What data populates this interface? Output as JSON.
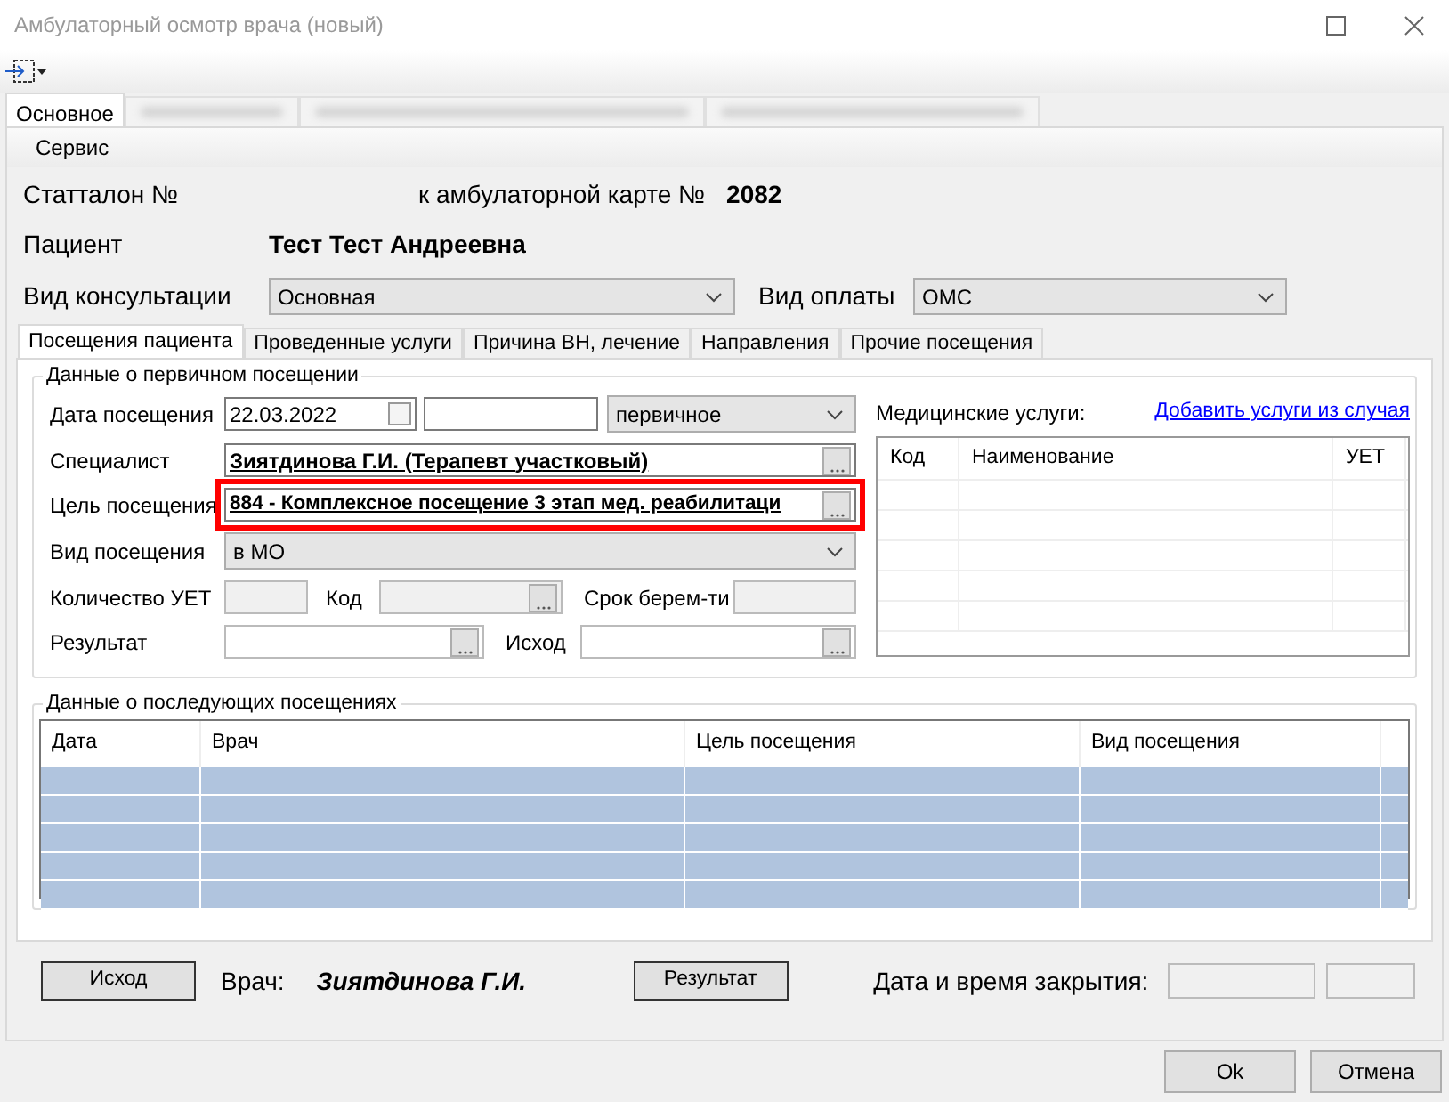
{
  "window": {
    "title": "Амбулаторный осмотр врача (новый)"
  },
  "main_tabs": [
    {
      "label": "Основное",
      "selected": true
    }
  ],
  "menu": [
    "Сервис"
  ],
  "header": {
    "stattalon_label": "Статталон №",
    "card_label": "к амбулаторной карте №",
    "card_number": "2082",
    "patient_label": "Пациент",
    "patient_name": "Тест Тест Андреевна",
    "consult_label": "Вид консультации",
    "consult_value": "Основная",
    "payment_label": "Вид оплаты",
    "payment_value": "ОМС"
  },
  "inner_tabs": [
    {
      "label": "Посещения пациента",
      "selected": true
    },
    {
      "label": "Проведенные услуги",
      "selected": false
    },
    {
      "label": "Причина ВН, лечение",
      "selected": false
    },
    {
      "label": "Направления",
      "selected": false
    },
    {
      "label": "Прочие посещения",
      "selected": false
    }
  ],
  "primary_visit": {
    "title": "Данные о первичном посещении",
    "date_label": "Дата посещения",
    "date_value": "22.03.2022",
    "date_checked": false,
    "visit_type_value": "первичное",
    "specialist_label": "Специалист",
    "specialist_value": "Зиятдинова Г.И. (Терапевт участковый)",
    "purpose_label": "Цель посещения",
    "purpose_value": "884 - Комплексное посещение 3 этап мед. реабилитаци",
    "purpose_highlighted": true,
    "kind_label": "Вид посещения",
    "kind_value": "в МО",
    "uet_label": "Количество УЕТ",
    "code_label": "Код",
    "term_label": "Срок берем-ти",
    "result_label": "Результат",
    "outcome_label": "Исход",
    "services_label": "Медицинские услуги:",
    "services_link": "Добавить услуги из случая",
    "services_columns": [
      "Код",
      "Наименование",
      "УЕТ"
    ]
  },
  "later_visits": {
    "title": "Данные о последующих посещениях",
    "columns": [
      "Дата",
      "Врач",
      "Цель посещения",
      "Вид посещения"
    ],
    "rows": [
      {
        "selected": true
      },
      {
        "selected": true
      },
      {
        "selected": true
      },
      {
        "selected": true
      },
      {
        "selected": true
      }
    ]
  },
  "bottom": {
    "outcome_button": "Исход",
    "doctor_label": "Врач:",
    "doctor_name": "Зиятдинова Г.И.",
    "result_button": "Результат",
    "close_label": "Дата и время закрытия:"
  },
  "buttons": [
    "Ok",
    "Отмена"
  ]
}
